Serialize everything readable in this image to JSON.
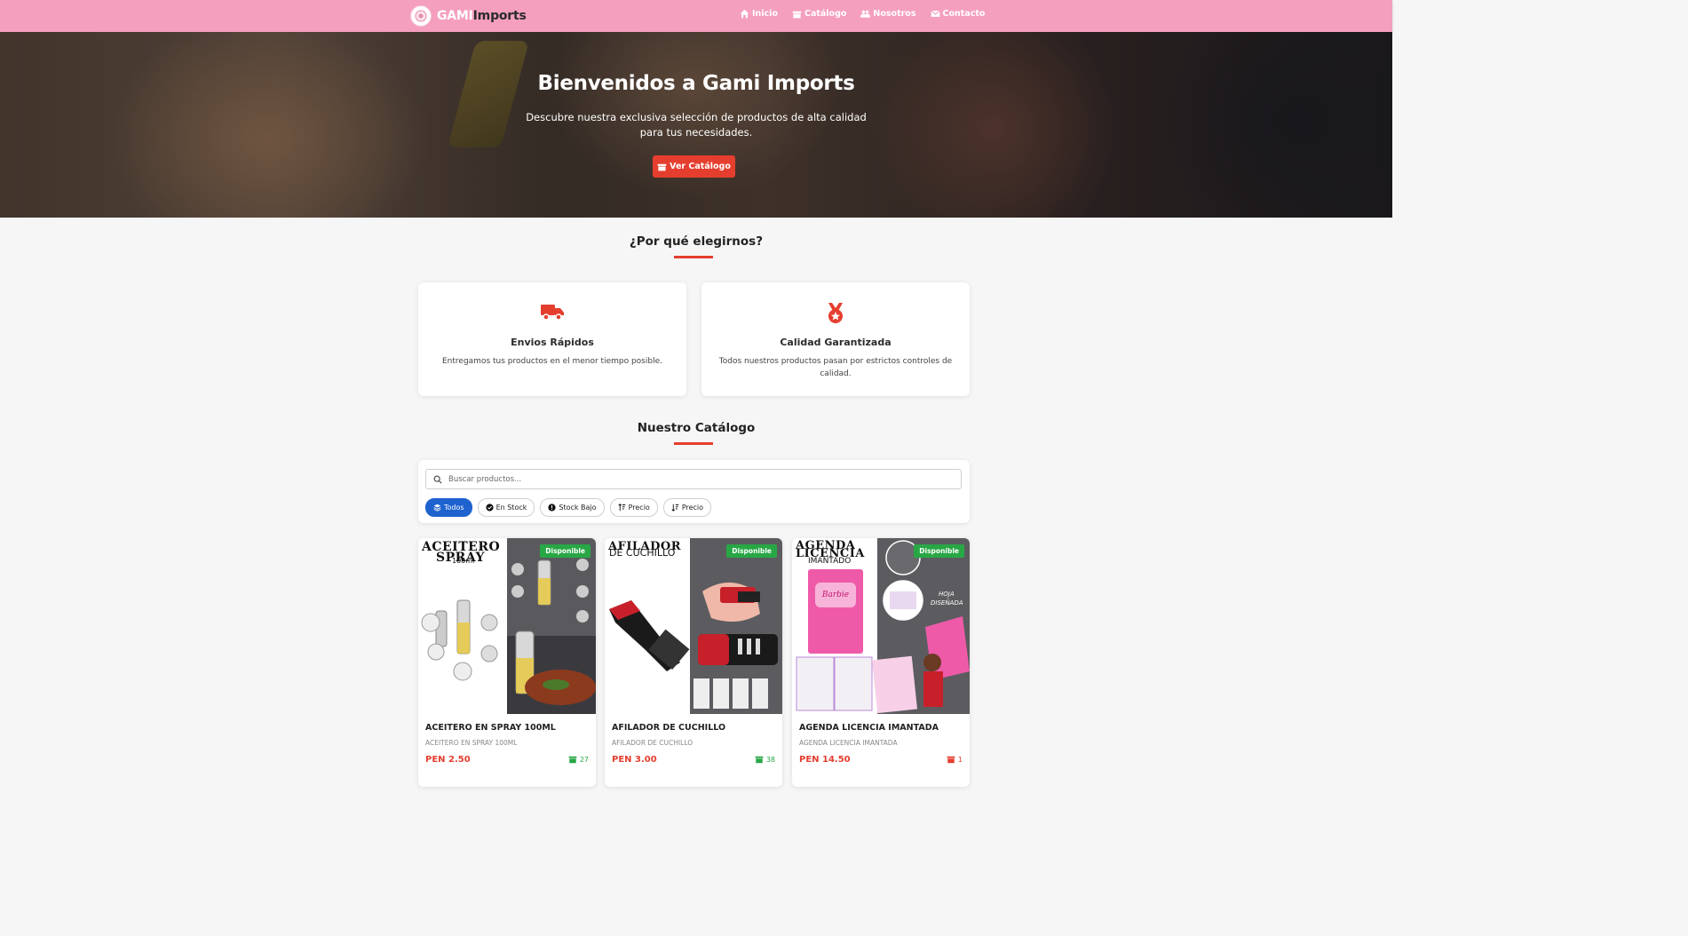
{
  "brand": {
    "part1": "GAMI",
    "part2": "Imports"
  },
  "nav": [
    {
      "label": "Inicio",
      "icon": "home-icon"
    },
    {
      "label": "Catálogo",
      "icon": "box-icon"
    },
    {
      "label": "Nosotros",
      "icon": "users-icon"
    },
    {
      "label": "Contacto",
      "icon": "envelope-icon"
    }
  ],
  "hero": {
    "title": "Bienvenidos a Gami Imports",
    "subtitle": "Descubre nuestra exclusiva selección de productos de alta calidad para tus necesidades.",
    "button": "Ver Catálogo"
  },
  "why": {
    "title": "¿Por qué elegirnos?",
    "features": [
      {
        "icon": "truck-icon",
        "title": "Envios Rápidos",
        "desc": "Entregamos tus productos en el menor tiempo posible."
      },
      {
        "icon": "medal-icon",
        "title": "Calidad Garantizada",
        "desc": "Todos nuestros productos pasan por estrictos controles de calidad."
      }
    ]
  },
  "catalog": {
    "title": "Nuestro Catálogo",
    "search_placeholder": "Buscar productos...",
    "filters": [
      {
        "label": "Todos",
        "icon": "layers-icon",
        "active": true
      },
      {
        "label": "En Stock",
        "icon": "check-circle-icon",
        "active": false
      },
      {
        "label": "Stock Bajo",
        "icon": "exclamation-circle-icon",
        "active": false
      },
      {
        "label": "Precio",
        "icon": "sort-up-icon",
        "active": false
      },
      {
        "label": "Precio",
        "icon": "sort-down-icon",
        "active": false
      }
    ],
    "products": [
      {
        "name": "ACEITERO EN SPRAY 100ML",
        "desc": "ACEITERO EN SPRAY 100ML",
        "price": "PEN 2.50",
        "stock": "27",
        "stock_color": "#28a745",
        "badge": "Disponible",
        "img_title_1": "ACEITERO",
        "img_title_2": "SPRAY",
        "img_sub": "100ml"
      },
      {
        "name": "AFILADOR DE CUCHILLO",
        "desc": "AFILADOR DE CUCHILLO",
        "price": "PEN 3.00",
        "stock": "38",
        "stock_color": "#28a745",
        "badge": "Disponible",
        "img_title_1": "AFILADOR",
        "img_sub": "DE CUCHILLO"
      },
      {
        "name": "AGENDA LICENCIA IMANTADA",
        "desc": "AGENDA LICENCIA IMANTADA",
        "price": "PEN 14.50",
        "stock": "1",
        "stock_color": "#e53e2f",
        "badge": "Disponible",
        "img_title_1": "AGENDA",
        "img_title_2": "LICENCIA",
        "img_sub": "IMANTADO",
        "img_note_1": "HOJA",
        "img_note_2": "DISEÑADA"
      }
    ]
  }
}
